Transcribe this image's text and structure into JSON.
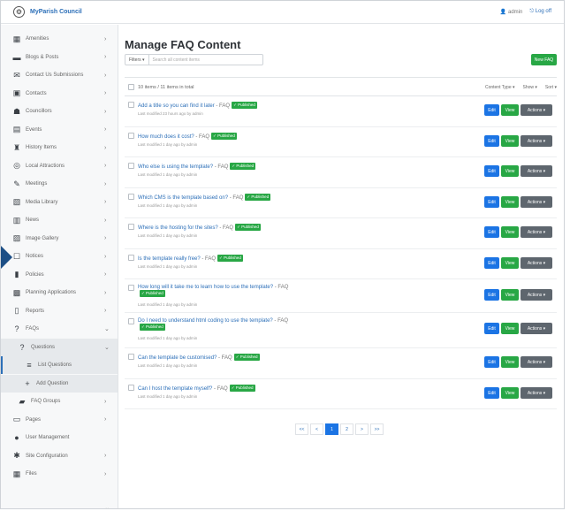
{
  "app": {
    "brand": "MyParish Council",
    "user": "admin",
    "logout": "Log off"
  },
  "sidebar": {
    "items": [
      {
        "label": "Amenities",
        "icon": "building-icon"
      },
      {
        "label": "Blogs & Posts",
        "icon": "bed-icon"
      },
      {
        "label": "Contact Us Submissions",
        "icon": "envelope-icon"
      },
      {
        "label": "Contacts",
        "icon": "id-card-icon"
      },
      {
        "label": "Councillors",
        "icon": "group-icon"
      },
      {
        "label": "Events",
        "icon": "calendar-icon"
      },
      {
        "label": "History Items",
        "icon": "landmark-icon"
      },
      {
        "label": "Local Attractions",
        "icon": "binoculars-icon"
      },
      {
        "label": "Meetings",
        "icon": "comments-icon"
      },
      {
        "label": "Media Library",
        "icon": "media-icon"
      },
      {
        "label": "News",
        "icon": "newspaper-icon"
      },
      {
        "label": "Image Gallery",
        "icon": "images-icon"
      },
      {
        "label": "Notices",
        "icon": "clipboard-icon"
      },
      {
        "label": "Policies",
        "icon": "document-icon"
      },
      {
        "label": "Planning Applications",
        "icon": "planning-icon"
      },
      {
        "label": "Reports",
        "icon": "report-icon"
      },
      {
        "label": "FAQs",
        "icon": "question-icon"
      }
    ],
    "faq_sub": [
      {
        "label": "Questions",
        "icon": "question-circle-icon"
      },
      {
        "label": "List Questions",
        "icon": "list-icon"
      },
      {
        "label": "Add Question",
        "icon": "plus-icon"
      },
      {
        "label": "FAQ Groups",
        "icon": "folder-icon"
      }
    ],
    "bottom": [
      {
        "label": "Pages",
        "icon": "page-icon"
      },
      {
        "label": "User Management",
        "icon": "user-icon"
      },
      {
        "label": "Site Configuration",
        "icon": "cogs-icon"
      },
      {
        "label": "Files",
        "icon": "files-icon"
      }
    ],
    "collapse": "«"
  },
  "main": {
    "title": "Manage FAQ Content",
    "filter_label": "Filters ▾",
    "search_placeholder": "Search all content items",
    "new_button": "New FAQ",
    "count": "10 items / 11 items in total",
    "filters": [
      "Content Type ▾",
      "Show ▾",
      "Sort ▾"
    ],
    "kind_label": " - FAQ",
    "badge": "✓ Published",
    "actions": {
      "edit": "Edit",
      "view": "View",
      "more": "Actions ▾"
    },
    "items": [
      {
        "title": "Add a title so you can find it later",
        "meta": "Last modified 23 hours ago by admin"
      },
      {
        "title": "How much does it cost?",
        "meta": "Last modified 1 day ago by admin"
      },
      {
        "title": "Who else is using the template?",
        "meta": "Last modified 1 day ago by admin"
      },
      {
        "title": "Which CMS is the template based on?",
        "meta": "Last modified 1 day ago by admin"
      },
      {
        "title": "Where is the hosting for the sites?",
        "meta": "Last modified 1 day ago by admin"
      },
      {
        "title": "Is the template really free?",
        "meta": "Last modified 1 day ago by admin"
      },
      {
        "title": "How long will it take me to learn how to use the template?",
        "meta": "Last modified 1 day ago by admin"
      },
      {
        "title": "Do I need to understand html coding to use the template?",
        "meta": "Last modified 1 day ago by admin"
      },
      {
        "title": "Can the template be customised?",
        "meta": "Last modified 1 day ago by admin"
      },
      {
        "title": "Can I host the template myself?",
        "meta": "Last modified 1 day ago by admin"
      }
    ],
    "pagination": [
      "<<",
      "<",
      "1",
      "2",
      ">",
      ">>"
    ]
  }
}
